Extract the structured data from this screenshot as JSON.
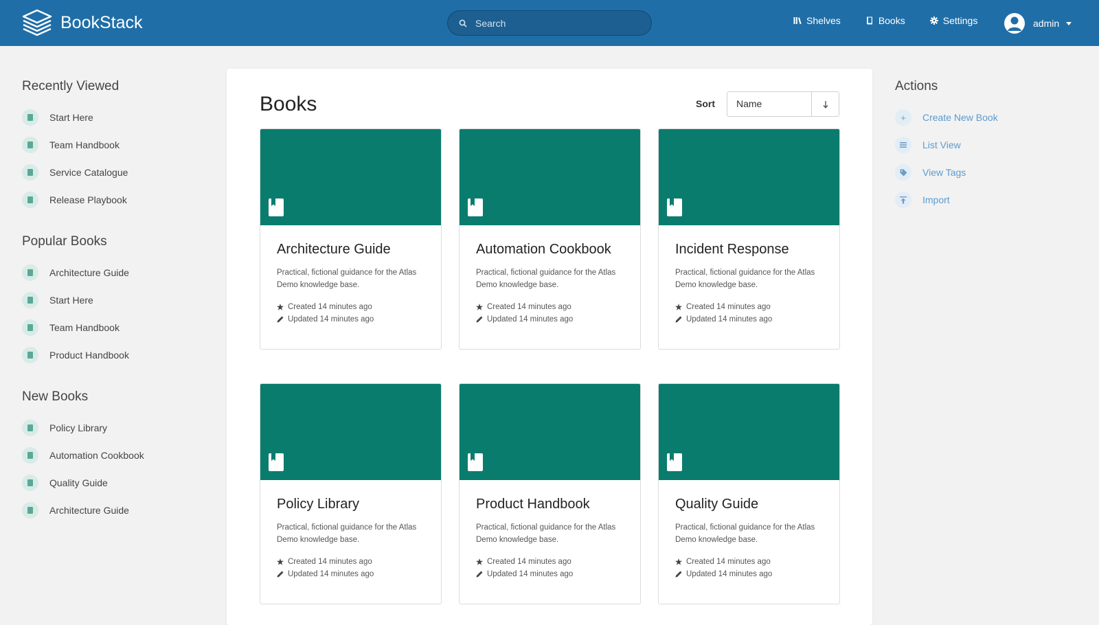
{
  "header": {
    "app_name": "BookStack",
    "search_placeholder": "Search",
    "nav": [
      {
        "label": "Shelves",
        "icon": "shelves-icon"
      },
      {
        "label": "Books",
        "icon": "books-icon"
      },
      {
        "label": "Settings",
        "icon": "gear-icon"
      }
    ],
    "user": "admin"
  },
  "colors": {
    "header": "#206ea7",
    "cover": "#0a7c6e",
    "link": "#5b9bd0"
  },
  "left": {
    "recently_viewed": {
      "title": "Recently Viewed",
      "items": [
        "Start Here",
        "Team Handbook",
        "Service Catalogue",
        "Release Playbook"
      ]
    },
    "popular_books": {
      "title": "Popular Books",
      "items": [
        "Architecture Guide",
        "Start Here",
        "Team Handbook",
        "Product Handbook"
      ]
    },
    "new_books": {
      "title": "New Books",
      "items": [
        "Policy Library",
        "Automation Cookbook",
        "Quality Guide",
        "Architecture Guide"
      ]
    }
  },
  "main": {
    "title": "Books",
    "sort_label": "Sort",
    "sort_value": "Name",
    "sort_direction": "↓",
    "books": [
      {
        "title": "Architecture Guide",
        "desc": "Practical, fictional guidance for the Atlas Demo knowledge base.",
        "created": "Created 14 minutes ago",
        "updated": "Updated 14 minutes ago"
      },
      {
        "title": "Automation Cookbook",
        "desc": "Practical, fictional guidance for the Atlas Demo knowledge base.",
        "created": "Created 14 minutes ago",
        "updated": "Updated 14 minutes ago"
      },
      {
        "title": "Incident Response",
        "desc": "Practical, fictional guidance for the Atlas Demo knowledge base.",
        "created": "Created 14 minutes ago",
        "updated": "Updated 14 minutes ago"
      },
      {
        "title": "Policy Library",
        "desc": "Practical, fictional guidance for the Atlas Demo knowledge base.",
        "created": "Created 14 minutes ago",
        "updated": "Updated 14 minutes ago"
      },
      {
        "title": "Product Handbook",
        "desc": "Practical, fictional guidance for the Atlas Demo knowledge base.",
        "created": "Created 14 minutes ago",
        "updated": "Updated 14 minutes ago"
      },
      {
        "title": "Quality Guide",
        "desc": "Practical, fictional guidance for the Atlas Demo knowledge base.",
        "created": "Created 14 minutes ago",
        "updated": "Updated 14 minutes ago"
      }
    ]
  },
  "right": {
    "title": "Actions",
    "actions": [
      {
        "label": "Create New Book",
        "icon": "plus-icon"
      },
      {
        "label": "List View",
        "icon": "list-icon"
      },
      {
        "label": "View Tags",
        "icon": "tag-icon"
      },
      {
        "label": "Import",
        "icon": "import-icon"
      }
    ]
  }
}
